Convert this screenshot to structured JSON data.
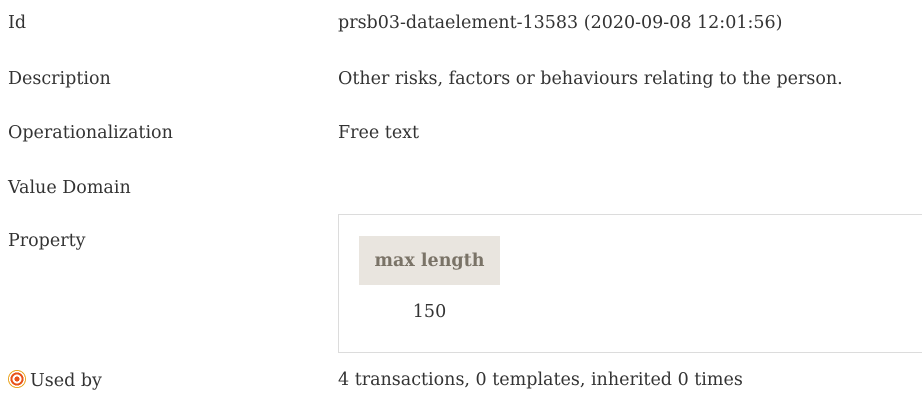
{
  "rows": {
    "id": {
      "label": "Id",
      "value": "prsb03-dataelement-13583 (2020-09-08 12:01:56)"
    },
    "description": {
      "label": "Description",
      "value": "Other risks, factors or behaviours relating to the person."
    },
    "operationalization": {
      "label": "Operationalization",
      "value": "Free text"
    },
    "value_domain": {
      "label": "Value Domain"
    },
    "property": {
      "label": "Property",
      "header": "max length",
      "value": "150"
    },
    "used_by": {
      "label": "Used by",
      "icon": "target-icon",
      "value": "4 transactions, 0 templates, inherited 0 times"
    }
  },
  "colors": {
    "text": "#333333",
    "header_bg": "#e9e5df",
    "header_text": "#7a7367",
    "icon_orange": "#e8531b"
  }
}
